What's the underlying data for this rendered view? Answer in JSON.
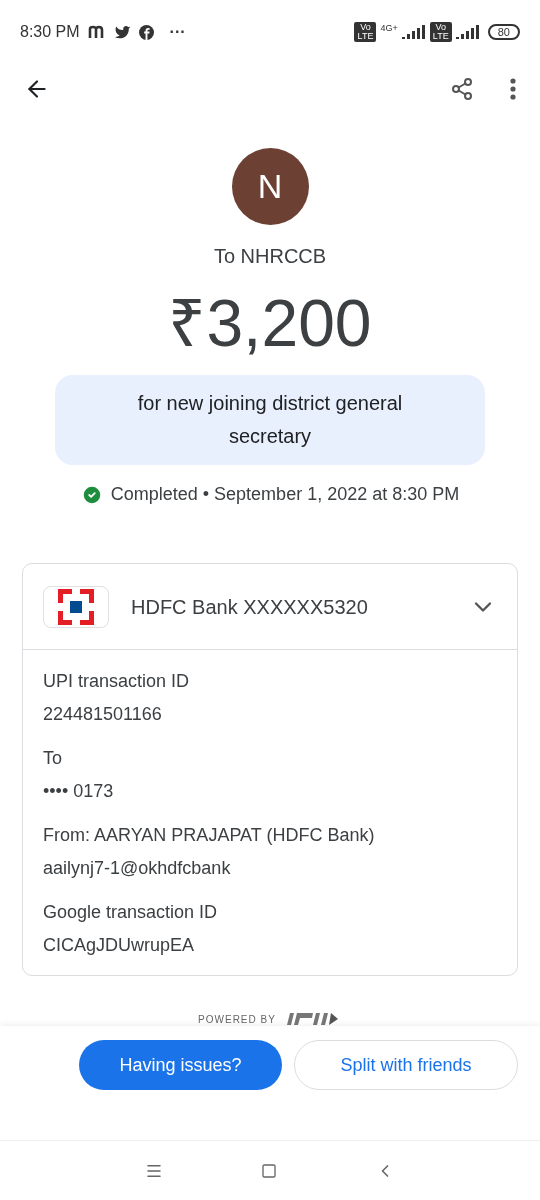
{
  "status_bar": {
    "time": "8:30 PM",
    "more": "···",
    "volte": [
      "Vo LTE",
      "Vo LTE"
    ],
    "network": "4G+",
    "battery": "80"
  },
  "payee": {
    "initial": "N",
    "title": "To NHRCCB"
  },
  "amount": "₹3,200",
  "note": "for new joining district general secretary",
  "status": {
    "label": "Completed",
    "separator": "•",
    "date": "September 1, 2022 at 8:30 PM"
  },
  "account": {
    "name": "HDFC Bank XXXXXX5320",
    "expanded": true
  },
  "details": [
    {
      "label": "UPI transaction ID",
      "value": "224481501166"
    },
    {
      "label": "To",
      "value": "•••• 0173"
    },
    {
      "label": "From: AARYAN PRAJAPAT (HDFC Bank)",
      "value": "aailynj7-1@okhdfcbank"
    },
    {
      "label": "Google transaction ID",
      "value": "CICAgJDUwrupEA"
    }
  ],
  "powered_by": "POWERED BY",
  "buttons": [
    {
      "label": "Having issues?",
      "kind": "primary"
    },
    {
      "label": "Split with friends",
      "kind": "outline"
    }
  ]
}
